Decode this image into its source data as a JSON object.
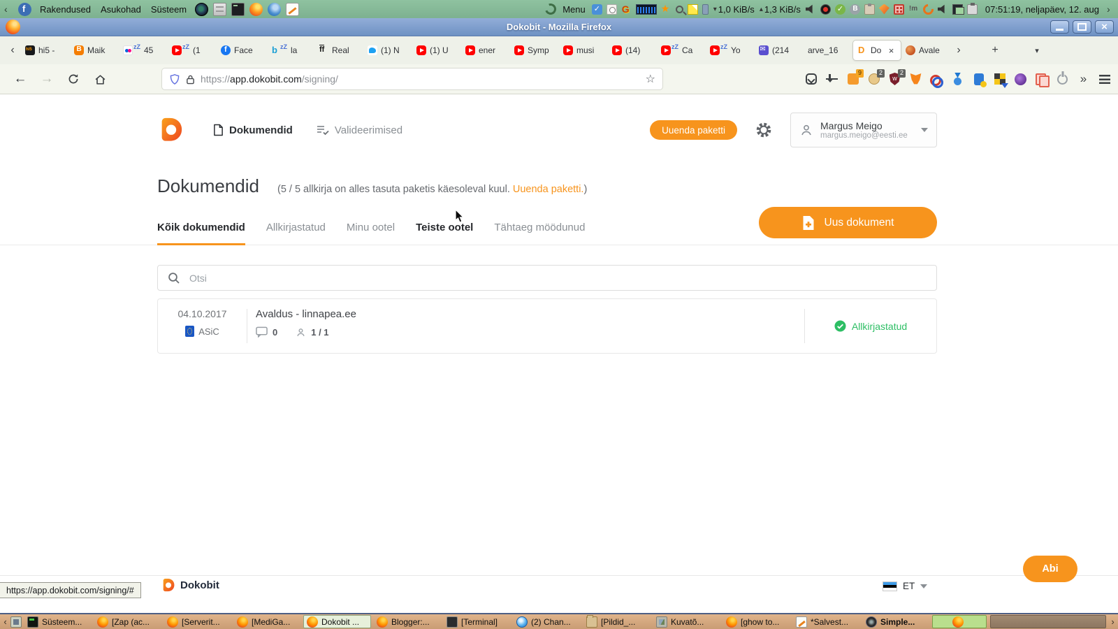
{
  "desktop": {
    "panel": {
      "menus": [
        "Rakendused",
        "Asukohad",
        "Süsteem"
      ],
      "menu_label": "Menu",
      "launchers": [
        {
          "name": "screenshot-camera-icon",
          "ic": "camera"
        },
        {
          "name": "file-cabinet-icon",
          "ic": "cabinet"
        },
        {
          "name": "terminal-launcher-icon",
          "ic": "terminal"
        },
        {
          "name": "firefox-launcher-icon",
          "ic": "firefox"
        },
        {
          "name": "thunderbird-launcher-icon",
          "ic": "thunderbird"
        },
        {
          "name": "text-editor-launcher-icon",
          "ic": "notepad"
        }
      ],
      "tray_left": [
        {
          "name": "tasks-check-icon",
          "ic": "todo"
        },
        {
          "name": "time-tracker-icon",
          "ic": "clockdoc"
        },
        {
          "name": "gimp-icon",
          "ic": "gimp"
        },
        {
          "name": "network-graph-icon",
          "ic": "graph"
        },
        {
          "name": "favorites-star-icon",
          "ic": "star"
        },
        {
          "name": "search-tray-icon",
          "ic": "magnifier"
        },
        {
          "name": "sticky-note-icon",
          "ic": "note"
        },
        {
          "name": "pin-icon",
          "ic": "pin"
        }
      ],
      "net_down": "1,0 KiB/s",
      "net_up": "1,3 KiB/s",
      "tray_right": [
        {
          "name": "volume-icon",
          "ic": "volume"
        },
        {
          "name": "screen-recorder-icon",
          "ic": "record"
        },
        {
          "name": "updates-ok-icon",
          "ic": "check"
        },
        {
          "name": "bluetooth-icon",
          "ic": "bluetooth"
        },
        {
          "name": "clipboard-icon",
          "ic": "clipboard"
        },
        {
          "name": "gem-app-icon",
          "ic": "gem"
        },
        {
          "name": "calculator-icon",
          "ic": "calc"
        },
        {
          "name": "messenger-icon",
          "ic": "im"
        },
        {
          "name": "sync-icon",
          "ic": "sync"
        },
        {
          "name": "volume-mixer-icon",
          "ic": "volume"
        },
        {
          "name": "displays-icon",
          "ic": "monitors"
        },
        {
          "name": "power-plug-icon",
          "ic": "plug"
        }
      ],
      "clock": "07:51:19, neljapäev, 12. aug"
    },
    "status_tooltip": "https://app.dokobit.com/signing/#",
    "taskbar": {
      "items": [
        {
          "label": "Süsteem...",
          "ic": "terminal-green"
        },
        {
          "label": "[Zap (ac...",
          "ic": "firefox"
        },
        {
          "label": "[Serverit...",
          "ic": "firefox"
        },
        {
          "label": "[MediGa...",
          "ic": "firefox"
        },
        {
          "label": "Dokobit ...",
          "ic": "firefox",
          "active": true
        },
        {
          "label": "Blogger:...",
          "ic": "firefox"
        },
        {
          "label": "[Terminal]",
          "ic": "terminal"
        },
        {
          "label": "(2) Chan...",
          "ic": "globe"
        },
        {
          "label": "[Pildid_...",
          "ic": "folder"
        },
        {
          "label": "Kuvatõ...",
          "ic": "image"
        },
        {
          "label": "[ghow to...",
          "ic": "firefox"
        },
        {
          "label": "*Salvest...",
          "ic": "editor"
        },
        {
          "label": "Simple...",
          "ic": "recorder",
          "bold": true
        },
        {
          "label": "",
          "ic": "firefox",
          "green": true
        }
      ]
    }
  },
  "browser": {
    "window_title": "Dokobit - Mozilla Firefox",
    "tabs": [
      {
        "label": "hi5 -",
        "ic": "hi5"
      },
      {
        "label": "Maik",
        "ic": "blogger"
      },
      {
        "label": "45",
        "ic": "flickr",
        "sleep": true
      },
      {
        "label": "(1",
        "ic": "youtube",
        "sleep": true
      },
      {
        "label": "Face",
        "ic": "facebook"
      },
      {
        "label": "la",
        "ic": "bing",
        "sleep": true
      },
      {
        "label": "Real",
        "ic": "flashscore"
      },
      {
        "label": "(1) N",
        "ic": "twitter"
      },
      {
        "label": "(1) U",
        "ic": "youtube"
      },
      {
        "label": "ener",
        "ic": "youtube"
      },
      {
        "label": "Symp",
        "ic": "youtube"
      },
      {
        "label": "musi",
        "ic": "youtube"
      },
      {
        "label": "(14)",
        "ic": "youtube"
      },
      {
        "label": "Ca",
        "ic": "youtube",
        "sleep": true
      },
      {
        "label": "Yo",
        "ic": "youtube",
        "sleep": true
      },
      {
        "label": "(214",
        "ic": "mail"
      },
      {
        "label": "arve_16",
        "ic": "none"
      },
      {
        "label": "Do",
        "ic": "dokobit",
        "active": true
      },
      {
        "label": "Avale",
        "ic": "mars"
      }
    ],
    "url": {
      "scheme": "https://",
      "host": "app.dokobit.com",
      "path": "/signing/"
    },
    "ext_icons": [
      {
        "name": "pocket-icon",
        "ic": "pocket"
      },
      {
        "name": "downloads-icon",
        "ic": "download"
      },
      {
        "name": "shopping-ext-icon",
        "ic": "basket",
        "badge": "9",
        "badge_orange": true
      },
      {
        "name": "cookie-ext-icon",
        "ic": "cookies",
        "badge": "2"
      },
      {
        "name": "privacy-shield-ext-icon",
        "ic": "shield",
        "badge": "2"
      },
      {
        "name": "metamask-icon",
        "ic": "metamask"
      },
      {
        "name": "link-chain-ext-icon",
        "ic": "chain"
      },
      {
        "name": "medal-ext-icon",
        "ic": "medal"
      },
      {
        "name": "save-page-ext-icon",
        "ic": "docdl"
      },
      {
        "name": "video-downloader-ext-icon",
        "ic": "videodl"
      },
      {
        "name": "container-mask-ext-icon",
        "ic": "mask"
      },
      {
        "name": "tab-copies-ext-icon",
        "ic": "copies"
      },
      {
        "name": "power-ext-icon",
        "ic": "power"
      },
      {
        "name": "overflow-chevrons-icon",
        "ic": "overflow"
      },
      {
        "name": "app-menu-icon",
        "ic": "hamburger"
      }
    ]
  },
  "app": {
    "header": {
      "nav_documents": "Dokumendid",
      "nav_validations": "Valideerimised",
      "upgrade_button": "Uuenda paketti",
      "user_name": "Margus Meigo",
      "user_email": "margus.meigo@eesti.ee"
    },
    "page_title": "Dokumendid",
    "quota_prefix": "(5 / 5 allkirja on alles tasuta paketis käesoleval kuul. ",
    "quota_link": "Uuenda paketti.",
    "quota_suffix": ")",
    "tabs": [
      {
        "label": "Kõik dokumendid",
        "active": true
      },
      {
        "label": "Allkirjastatud"
      },
      {
        "label": "Minu ootel"
      },
      {
        "label": "Teiste ootel",
        "hover": true
      },
      {
        "label": "Tähtaeg möödunud"
      }
    ],
    "new_document_button": "Uus dokument",
    "search_placeholder": "Otsi",
    "documents": [
      {
        "date": "04.10.2017",
        "format": "ASiC",
        "title": "Avaldus - linnapea.ee",
        "comments": "0",
        "signed": "1 / 1",
        "status": "Allkirjastatud"
      }
    ],
    "footer": {
      "brand": "Dokobit",
      "language": "ET",
      "help_button": "Abi"
    },
    "colors": {
      "accent_orange": "#f7941d",
      "status_green": "#2dbe64"
    }
  }
}
